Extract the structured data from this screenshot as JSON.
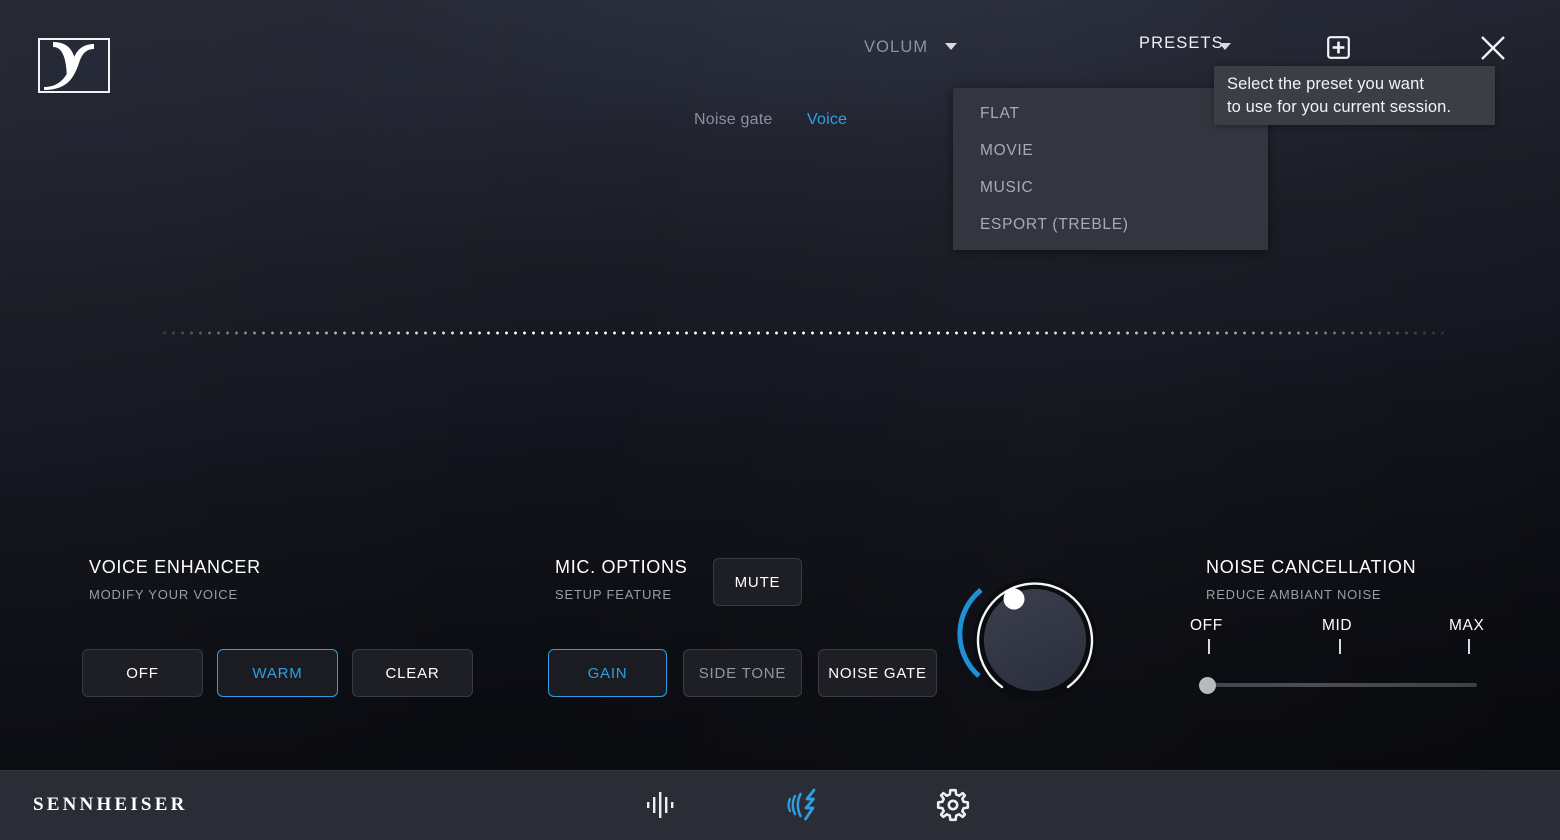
{
  "app": {
    "brand": "SENNHEISER",
    "accent_color": "#2e9fe0",
    "background_top_color": "#252833",
    "background_bottom_color": "#08090d",
    "bottom_bar_color": "#2a2d36"
  },
  "titlebar": {
    "logo_icon": "sennheiser-logo-icon",
    "volume": {
      "label": "VOLUME",
      "caret_icon": "chevron-down-icon"
    },
    "presets": {
      "label": "PRESETS",
      "caret_icon": "chevron-down-icon"
    },
    "add_icon": "add-box-icon",
    "close_icon": "close-icon"
  },
  "presets_dropdown": {
    "open": true,
    "items": [
      {
        "label": "FLAT"
      },
      {
        "label": "MOVIE"
      },
      {
        "label": "MUSIC"
      },
      {
        "label": "ESPORT (TREBLE)"
      }
    ]
  },
  "tooltip": {
    "line1": "Select the preset you want",
    "line2": "to use for you current session.",
    "background_color": "#3b3e45"
  },
  "tabs": [
    {
      "label": "Noise gate",
      "active": false
    },
    {
      "label": "Voice",
      "active": true
    }
  ],
  "voice_enhancer": {
    "title": "VOICE ENHANCER",
    "subtitle": "MODIFY YOUR VOICE",
    "options": [
      {
        "label": "OFF",
        "selected": false
      },
      {
        "label": "WARM",
        "selected": true
      },
      {
        "label": "CLEAR",
        "selected": false
      }
    ]
  },
  "mic_options": {
    "title": "MIC. OPTIONS",
    "subtitle": "SETUP FEATURE",
    "mute_label": "MUTE",
    "options": [
      {
        "label": "GAIN",
        "selected": true
      },
      {
        "label": "SIDE TONE",
        "selected": false
      },
      {
        "label": "NOISE GATE",
        "selected": false
      }
    ]
  },
  "volume_knob": {
    "name": "volume-knob",
    "indicator_position": "upper-left",
    "arc_color": "#1f8fd6"
  },
  "noise_cancellation": {
    "title": "NOISE CANCELLATION",
    "subtitle": "REDUCE AMBIANT NOISE",
    "scale": [
      {
        "label": "OFF"
      },
      {
        "label": "MID"
      },
      {
        "label": "MAX"
      }
    ],
    "slider_value_label": "OFF"
  },
  "bottom_nav": [
    {
      "icon": "equalizer-icon",
      "active": false
    },
    {
      "icon": "voice-waves-icon",
      "active": true
    },
    {
      "icon": "gear-icon",
      "active": false
    }
  ]
}
